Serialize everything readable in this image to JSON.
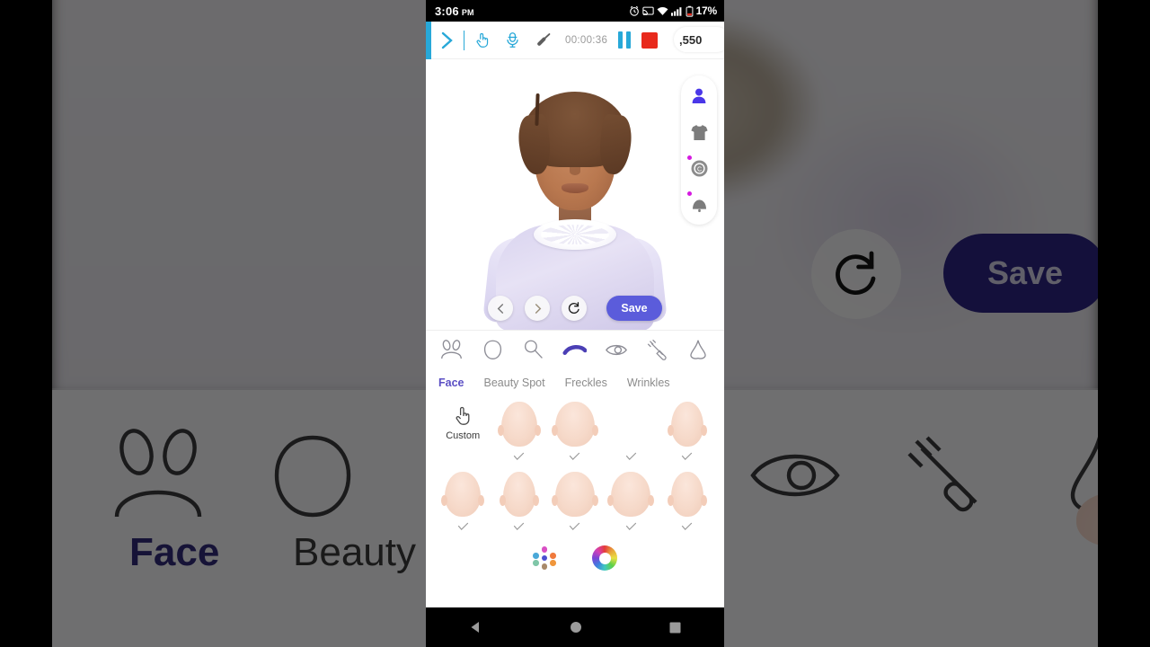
{
  "status_bar": {
    "time": "3:06",
    "ampm": "PM",
    "battery_percent": "17%",
    "icons": [
      "alarm-icon",
      "cast-icon",
      "wifi-icon",
      "signal-icon",
      "battery-icon"
    ]
  },
  "recorder_toolbar": {
    "collapse_icon": "chevron-right-icon",
    "touch_icon": "hand-touch-icon",
    "mic_icon": "microphone-icon",
    "brush_icon": "brush-icon",
    "elapsed_time": "00:00:36",
    "pause_icon": "pause-icon",
    "stop_icon": "stop-icon",
    "counter_pill": ",550"
  },
  "preview": {
    "rail": [
      {
        "name": "sidebar-item-avatar",
        "icon": "person-icon",
        "active": true,
        "badge": false
      },
      {
        "name": "sidebar-item-outfit",
        "icon": "tshirt-icon",
        "active": false,
        "badge": false
      },
      {
        "name": "sidebar-item-coins",
        "icon": "coin-badge-icon",
        "active": false,
        "badge": true
      },
      {
        "name": "sidebar-item-items",
        "icon": "bell-icon",
        "active": false,
        "badge": true
      }
    ],
    "controls": {
      "prev_icon": "chevron-left-icon",
      "next_icon": "chevron-right-icon",
      "reset_icon": "refresh-icon",
      "save_label": "Save"
    }
  },
  "category_icons": [
    {
      "name": "category-headband",
      "icon": "bunny-ears-icon",
      "active": false
    },
    {
      "name": "category-face",
      "icon": "head-outline-icon",
      "active": false
    },
    {
      "name": "category-makeup",
      "icon": "makeup-brush-icon",
      "active": false
    },
    {
      "name": "category-eyebrow",
      "icon": "eyebrow-icon",
      "active": true
    },
    {
      "name": "category-eye",
      "icon": "eye-icon",
      "active": false
    },
    {
      "name": "category-eyelash",
      "icon": "eyelash-wand-icon",
      "active": false
    },
    {
      "name": "category-nose",
      "icon": "nose-icon",
      "active": false
    }
  ],
  "sub_tabs": [
    {
      "label": "Face",
      "active": true
    },
    {
      "label": "Beauty Spot",
      "active": false
    },
    {
      "label": "Freckles",
      "active": false
    },
    {
      "label": "Wrinkles",
      "active": false
    }
  ],
  "custom": {
    "label": "Custom",
    "icon": "hand-tap-icon"
  },
  "thumbnail_rows": [
    [
      {
        "type": "custom"
      },
      {
        "type": "head",
        "shape": "oval",
        "checked": true
      },
      {
        "type": "head",
        "shape": "round",
        "checked": true
      },
      {
        "type": "head",
        "shape": "blank",
        "checked": true
      },
      {
        "type": "head",
        "shape": "narrow",
        "checked": true
      }
    ],
    [
      {
        "type": "head",
        "shape": "oval",
        "checked": true
      },
      {
        "type": "head",
        "shape": "narrow",
        "checked": true
      },
      {
        "type": "head",
        "shape": "wide",
        "checked": true
      },
      {
        "type": "head",
        "shape": "wide",
        "checked": true
      },
      {
        "type": "head",
        "shape": "narrow",
        "checked": true
      }
    ]
  ],
  "color_row": {
    "palette_icon": "color-palette-dots-icon",
    "wheel_icon": "color-wheel-icon",
    "palette_dots": [
      "#4aa8d8",
      "#d94fc4",
      "#f07a3c",
      "#4aa8d8",
      "#4b4fd0",
      "#f0963c",
      "#7fc6a8",
      "#a8896a",
      "#f0a85c"
    ]
  },
  "nav_bar": {
    "back_icon": "back-triangle-icon",
    "home_icon": "home-circle-icon",
    "recents_icon": "recents-square-icon"
  },
  "colors": {
    "accent_purple": "#5b5cdb",
    "tab_active": "#5b4fc4",
    "recorder_blue": "#27a8d8",
    "stop_red": "#e8291c",
    "badge_pink": "#d51ae0"
  },
  "background_overlay": {
    "magnified_tabs": [
      "Face",
      "Beauty Sp"
    ],
    "magnified_save_label": "Save"
  }
}
